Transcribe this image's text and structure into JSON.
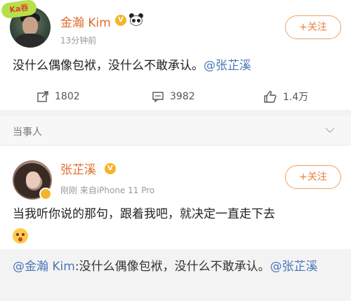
{
  "post1": {
    "badge_text": "Ka吞",
    "author": "金瀚 Kim",
    "time": "13分钟前",
    "follow_label": "+关注",
    "text": "没什么偶像包袱，没什么不敢承认。",
    "mention": "@张芷溪",
    "reposts": "1802",
    "comments": "3982",
    "likes": "1.4万"
  },
  "section": {
    "title": "当事人"
  },
  "post2": {
    "author": "张芷溪",
    "time_source": "刚刚  来自iPhone 11 Pro",
    "follow_label": "+关注",
    "text": "当我听你说的那句，跟着我吧，就决定一直走下去",
    "quoted_author": "@金瀚 Kim",
    "quoted_text": ":没什么偶像包袱，没什么不敢承认。",
    "quoted_mention": "@张芷溪"
  },
  "colors": {
    "accent_orange": "#e06c2a",
    "link_blue": "#4a76b8",
    "vip_gold": "#f6b42b"
  },
  "icons": [
    "repost-icon",
    "comment-icon",
    "like-icon",
    "chevron-down-icon",
    "panda-icon",
    "vip-badge-icon",
    "emoji-icon"
  ]
}
